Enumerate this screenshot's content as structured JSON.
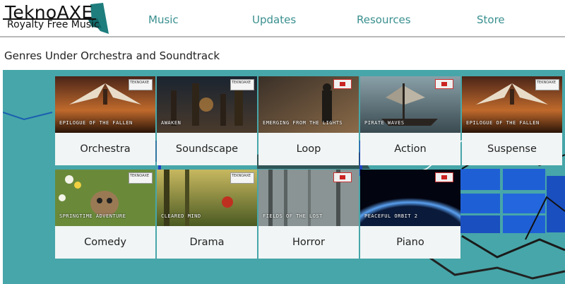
{
  "logo": {
    "title": "TeknoAXE",
    "subtitle": "Royalty Free Music"
  },
  "nav": {
    "music": "Music",
    "updates": "Updates",
    "resources": "Resources",
    "store": "Store"
  },
  "section_title": "Genres Under Orchestra and Soundtrack",
  "cards": [
    {
      "label": "Orchestra",
      "caption": "EPILOGUE OF THE FALLEN",
      "badge": "TEKNOAXE"
    },
    {
      "label": "Soundscape",
      "caption": "AWAKEN",
      "badge": "TEKNOAXE"
    },
    {
      "label": "Loop",
      "caption": "EMERGING FROM THE LIGHTS",
      "badge": ""
    },
    {
      "label": "Action",
      "caption": "PIRATE WAVES",
      "badge": ""
    },
    {
      "label": "Suspense",
      "caption": "EPILOGUE OF THE FALLEN",
      "badge": "TEKNOAXE"
    },
    {
      "label": "Comedy",
      "caption": "SPRINGTIME ADVENTURE",
      "badge": "TEKNOAXE"
    },
    {
      "label": "Drama",
      "caption": "CLEARED MIND",
      "badge": "TEKNOAXE"
    },
    {
      "label": "Horror",
      "caption": "FIELDS OF THE LOST",
      "badge": ""
    },
    {
      "label": "Piano",
      "caption": "PEACEFUL ORBIT 2",
      "badge": ""
    }
  ],
  "colors": {
    "nav": "#3a8f8f",
    "panel": "#47a6a9",
    "card": "#f1f5f5"
  }
}
